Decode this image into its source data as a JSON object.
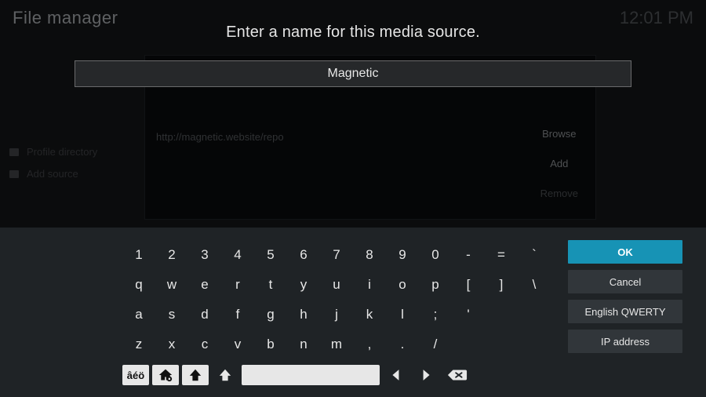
{
  "background": {
    "window_title": "File manager",
    "clock": "12:01 PM",
    "sidebar_items": [
      "Profile directory",
      "Add source"
    ],
    "panel": {
      "url_text": "http://magnetic.website/repo",
      "browse_label": "Browse",
      "add_label": "Add",
      "remove_label": "Remove"
    }
  },
  "dialog": {
    "prompt": "Enter a name for this media source.",
    "input_value": "Magnetic"
  },
  "keyboard": {
    "rows": [
      [
        "1",
        "2",
        "3",
        "4",
        "5",
        "6",
        "7",
        "8",
        "9",
        "0",
        "-",
        "=",
        "`"
      ],
      [
        "q",
        "w",
        "e",
        "r",
        "t",
        "y",
        "u",
        "i",
        "o",
        "p",
        "[",
        "]",
        "\\"
      ],
      [
        "a",
        "s",
        "d",
        "f",
        "g",
        "h",
        "j",
        "k",
        "l",
        ";",
        "'"
      ],
      [
        "z",
        "x",
        "c",
        "v",
        "b",
        "n",
        "m",
        ",",
        ".",
        "/"
      ]
    ],
    "side_buttons": {
      "ok": "OK",
      "cancel": "Cancel",
      "layout": "English QWERTY",
      "ip": "IP address"
    },
    "special": {
      "symbols_label": "âéö",
      "home_icon": "home-lock-icon",
      "shift_icon": "shift-icon",
      "space": " ",
      "left_icon": "caret-left-icon",
      "right_icon": "caret-right-icon",
      "backspace_icon": "backspace-icon"
    }
  }
}
